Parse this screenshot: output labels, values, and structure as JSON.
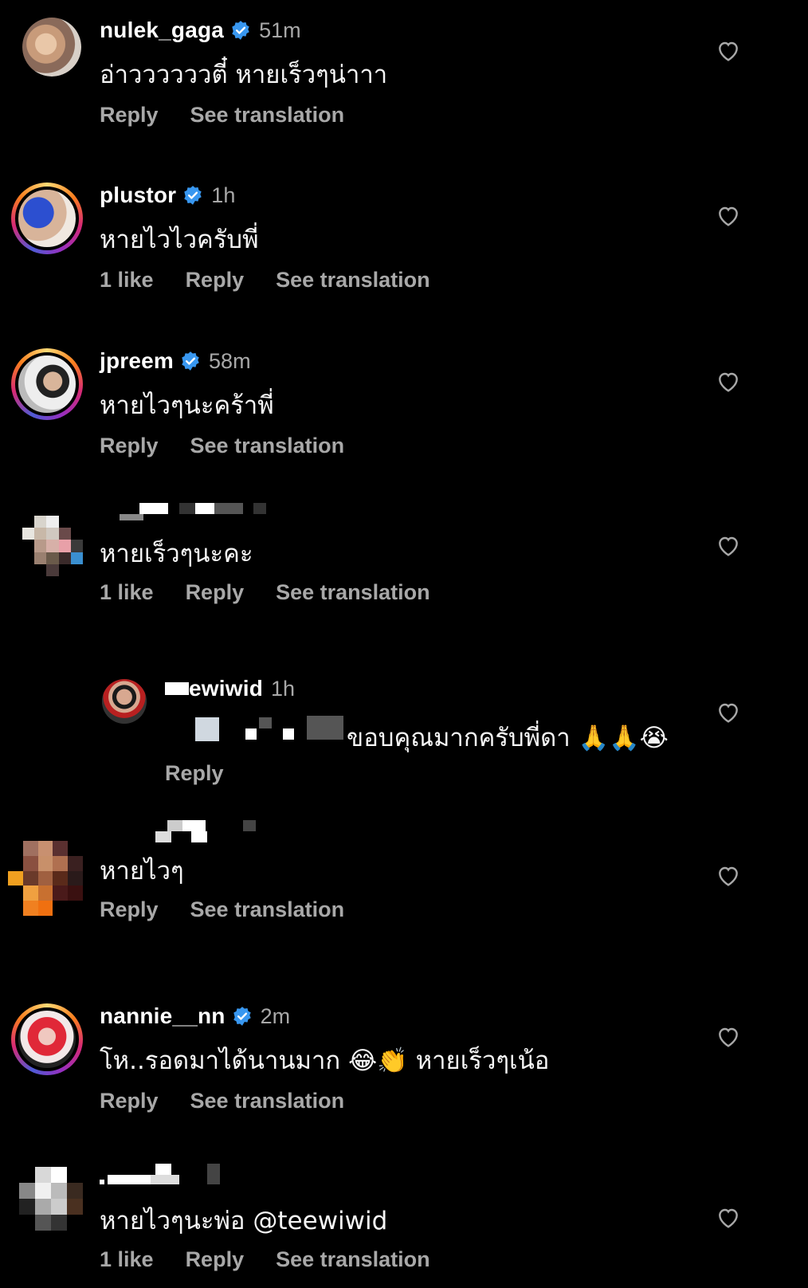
{
  "comments": [
    {
      "username": "nulek_gaga",
      "verified": true,
      "time": "51m",
      "text": "อ่าววววววตี๋ หายเร็วๆน่าาา",
      "likes": "",
      "reply": "Reply",
      "translate": "See translation"
    },
    {
      "username": "plustor",
      "verified": true,
      "time": "1h",
      "text": "หายไวไวครับพี่",
      "likes": "1 like",
      "reply": "Reply",
      "translate": "See translation"
    },
    {
      "username": "jpreem",
      "verified": true,
      "time": "58m",
      "text": "หายไวๆนะคร้าพี่",
      "likes": "",
      "reply": "Reply",
      "translate": "See translation"
    },
    {
      "username": "",
      "verified": false,
      "time": "",
      "text": "หายเร็วๆนะคะ",
      "likes": "1 like",
      "reply": "Reply",
      "translate": "See translation"
    },
    {
      "username": "ewiwid",
      "verified": false,
      "time": "1h",
      "text": "ขอบคุณมากครับพี่ดา 🙏🙏😭",
      "likes": "",
      "reply": "Reply",
      "translate": ""
    },
    {
      "username": "",
      "verified": false,
      "time": "",
      "text": "หายไวๆ",
      "likes": "",
      "reply": "Reply",
      "translate": "See translation"
    },
    {
      "username": "nannie__nn",
      "verified": true,
      "time": "2m",
      "text": "โห..รอดมาได้นานมาก 😂👏 หายเร็วๆเน้อ",
      "likes": "",
      "reply": "Reply",
      "translate": "See translation"
    },
    {
      "username": "",
      "verified": false,
      "time": "",
      "text": "หายไวๆนะพ่อ @teewiwid",
      "likes": "1 like",
      "reply": "Reply",
      "translate": "See translation"
    }
  ],
  "colors": {
    "background": "#000000",
    "secondary_text": "#a8a8a8",
    "verified_blue": "#3897f0"
  },
  "icons": {
    "heart": "heart-outline-icon",
    "verified": "verified-badge-icon"
  }
}
